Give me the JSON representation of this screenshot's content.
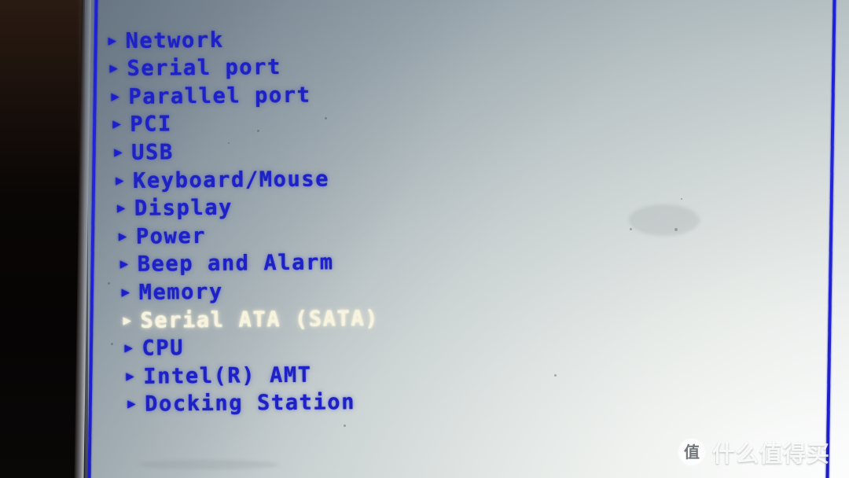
{
  "screen": {
    "type": "bios-setup-config-menu",
    "background_top_color": "#98a3ad",
    "background_bottom_color": "#ffffff",
    "border_color": "#1e21c6",
    "text_color": "#1e21c6",
    "selected_text_color": "#f7f3dd"
  },
  "menu": {
    "arrow_glyph": "▶",
    "selected_index": 10,
    "items": [
      {
        "label": "Network",
        "selected": false
      },
      {
        "label": "Serial port",
        "selected": false
      },
      {
        "label": "Parallel port",
        "selected": false
      },
      {
        "label": "PCI",
        "selected": false
      },
      {
        "label": "USB",
        "selected": false
      },
      {
        "label": "Keyboard/Mouse",
        "selected": false
      },
      {
        "label": "Display",
        "selected": false
      },
      {
        "label": "Power",
        "selected": false
      },
      {
        "label": "Beep and Alarm",
        "selected": false
      },
      {
        "label": "Memory",
        "selected": false
      },
      {
        "label": "Serial ATA (SATA)",
        "selected": true
      },
      {
        "label": "CPU",
        "selected": false
      },
      {
        "label": "Intel(R) AMT",
        "selected": false
      },
      {
        "label": "Docking Station",
        "selected": false
      }
    ]
  },
  "watermark": {
    "logo_char": "值",
    "text": "什么值得买"
  }
}
